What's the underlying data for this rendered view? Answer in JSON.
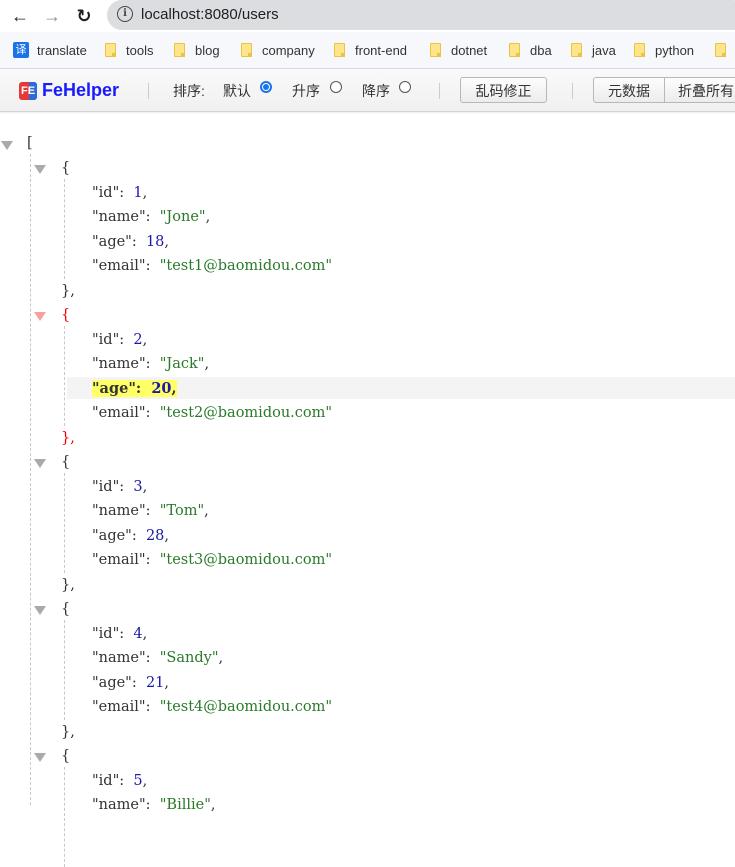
{
  "browser": {
    "url": "localhost:8080/users",
    "back_icon": "arrow-left-icon",
    "forward_icon": "arrow-right-icon",
    "reload_icon": "reload-icon",
    "bookmarks": [
      {
        "label": "translate",
        "icon": "translate-icon"
      },
      {
        "label": "tools",
        "icon": "folder-icon"
      },
      {
        "label": "blog",
        "icon": "folder-icon"
      },
      {
        "label": "company",
        "icon": "folder-icon"
      },
      {
        "label": "front-end",
        "icon": "folder-icon"
      },
      {
        "label": "dotnet",
        "icon": "folder-icon"
      },
      {
        "label": "dba",
        "icon": "folder-icon"
      },
      {
        "label": "java",
        "icon": "folder-icon"
      },
      {
        "label": "python",
        "icon": "folder-icon"
      }
    ]
  },
  "fehelper": {
    "logo_icon": "FE",
    "logo_text": "FeHelper",
    "sort_label": "排序:",
    "sort_options": [
      {
        "label": "默认",
        "selected": true
      },
      {
        "label": "升序",
        "selected": false
      },
      {
        "label": "降序",
        "selected": false
      }
    ],
    "fix_encoding_button": "乱码修正",
    "metadata_button": "元数据",
    "collapse_all_button": "折叠所有"
  },
  "json": {
    "open_bracket": "[",
    "records": [
      {
        "id": "1",
        "name": "\"Jone\"",
        "age": "18",
        "email": "\"test1@baomidou.com\""
      },
      {
        "id": "2",
        "name": "\"Jack\"",
        "age": "20",
        "email": "\"test2@baomidou.com\""
      },
      {
        "id": "3",
        "name": "\"Tom\"",
        "age": "28",
        "email": "\"test3@baomidou.com\""
      },
      {
        "id": "4",
        "name": "\"Sandy\"",
        "age": "21",
        "email": "\"test4@baomidou.com\""
      },
      {
        "id": "5",
        "name": "\"Billie\""
      }
    ],
    "keys": {
      "id": "\"id\":",
      "name": "\"name\":",
      "age": "\"age\":",
      "email": "\"email\":"
    },
    "open_brace": "{",
    "close_brace": "},",
    "highlighted_record_index": 1,
    "highlighted_key": "age"
  }
}
